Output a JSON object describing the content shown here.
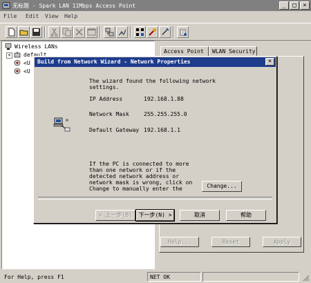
{
  "window": {
    "title": "无标题 - Spark LAN 11Mbps Access Point",
    "minimize_glyph": "_",
    "maximize_glyph": "□",
    "close_glyph": "×"
  },
  "menu": [
    {
      "label": "File"
    },
    {
      "label": "Edit"
    },
    {
      "label": "View"
    },
    {
      "label": "Help"
    }
  ],
  "toolbar": {
    "icons": [
      "new-file-icon",
      "open-folder-icon",
      "save-icon",
      "cut-icon",
      "copy-icon",
      "delete-icon",
      "properties-icon",
      "network-wizard-icon",
      "connect-icon",
      "settings-icon",
      "tools-icon",
      "help-icon"
    ]
  },
  "tree": {
    "root": "Wireless LANs",
    "child1": "default",
    "child2": "<U",
    "child3": "<U"
  },
  "tabs": [
    {
      "label": "Access Point"
    },
    {
      "label": "WLAN Security"
    }
  ],
  "panel_buttons": {
    "help": "Help...",
    "reset": "Reset",
    "apply": "Apply"
  },
  "status": {
    "help_text": "For Help, press F1",
    "net_status": "NET OK"
  },
  "dialog": {
    "title": "Build from Network Wizard - Network Properties",
    "close_glyph": "×",
    "intro_line1": "The wizard found the following network",
    "intro_line2": "settings.",
    "ip_label": "IP Address",
    "ip_value": "192.168.1.88",
    "mask_label": "Network Mask",
    "mask_value": "255.255.255.0",
    "gateway_label": "Default Gateway",
    "gateway_value": "192.168.1.1",
    "note_line1": "If the PC is connected to more",
    "note_line2": "than one network or if the",
    "note_line3": "detected network address or",
    "note_line4": "network mask is wrong, click on",
    "note_line5": "Change to manually enter the",
    "change_button": "Change...",
    "back_button": "< 上一步(B)",
    "next_button": "下一步(N) >",
    "cancel_button": "取消",
    "help_button": "帮助"
  }
}
